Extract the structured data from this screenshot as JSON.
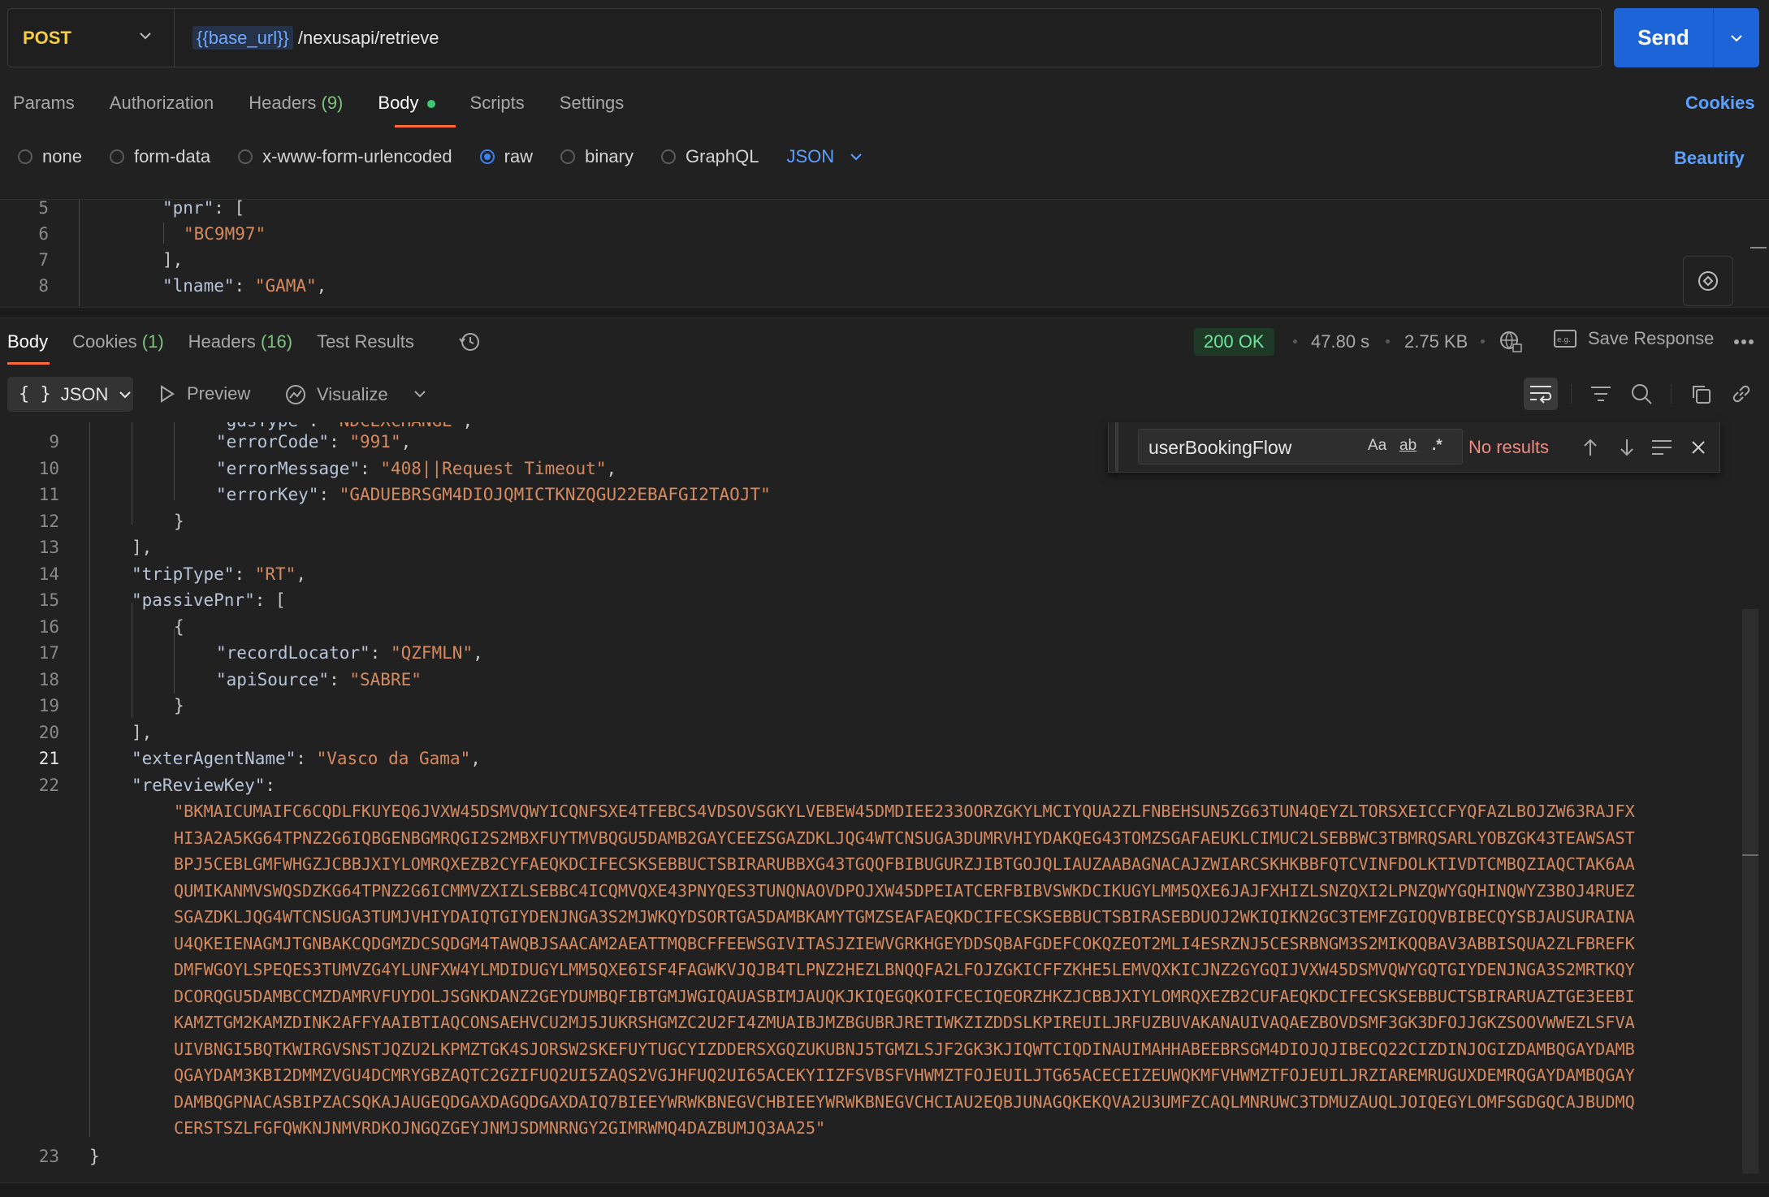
{
  "request": {
    "method": "POST",
    "url_variable": "{{base_url}}",
    "url_path": " /nexusapi/retrieve",
    "send_label": "Send"
  },
  "request_tabs": {
    "params": "Params",
    "authorization": "Authorization",
    "headers": "Headers",
    "headers_count": "(9)",
    "body": "Body",
    "scripts": "Scripts",
    "settings": "Settings",
    "cookies": "Cookies"
  },
  "body_types": {
    "none": "none",
    "form_data": "form-data",
    "urlencoded": "x-www-form-urlencoded",
    "raw": "raw",
    "binary": "binary",
    "graphql": "GraphQL",
    "selected_format": "JSON",
    "beautify": "Beautify"
  },
  "request_body_lines": [
    {
      "n": "5",
      "key": "\"pnr\"",
      "rest": ": ["
    },
    {
      "n": "6",
      "str": "\"BC9M97\""
    },
    {
      "n": "7",
      "punct": "],"
    },
    {
      "n": "8",
      "key": "\"lname\"",
      "rest": ": ",
      "str": "\"GAMA\"",
      "tail": ","
    }
  ],
  "response_tabs": {
    "body": "Body",
    "cookies": "Cookies",
    "cookies_count": "(1)",
    "headers": "Headers",
    "headers_count": "(16)",
    "test_results": "Test Results"
  },
  "response_meta": {
    "status": "200 OK",
    "time": "47.80 s",
    "size": "2.75 KB",
    "save_response": "Save Response"
  },
  "response_toolbar": {
    "format": "JSON",
    "preview": "Preview",
    "visualize": "Visualize"
  },
  "find": {
    "query": "userBookingFlow",
    "match_case": "Aa",
    "whole_word": "ab",
    "regex": ".*",
    "result": "No results"
  },
  "response_lines": [
    {
      "n": "9",
      "indent": 2,
      "key": "\"errorCode\"",
      "str": "\"991\"",
      "tail": ","
    },
    {
      "n": "10",
      "indent": 2,
      "key": "\"errorMessage\"",
      "str": "\"408||Request Timeout\"",
      "tail": ","
    },
    {
      "n": "11",
      "indent": 2,
      "key": "\"errorKey\"",
      "str": "\"GADUEBRSGM4DIOJQMICTKNZQGU22EBAFGI2TAOJT\""
    },
    {
      "n": "12",
      "indent": 1,
      "punct": "}"
    },
    {
      "n": "13",
      "indent": 0,
      "punct": "],"
    },
    {
      "n": "14",
      "indent": 0,
      "key": "\"tripType\"",
      "str": "\"RT\"",
      "tail": ","
    },
    {
      "n": "15",
      "indent": 0,
      "key": "\"passivePnr\"",
      "punct": ": ["
    },
    {
      "n": "16",
      "indent": 1,
      "punct": "{"
    },
    {
      "n": "17",
      "indent": 2,
      "key": "\"recordLocator\"",
      "str": "\"QZFMLN\"",
      "tail": ","
    },
    {
      "n": "18",
      "indent": 2,
      "key": "\"apiSource\"",
      "str": "\"SABRE\""
    },
    {
      "n": "19",
      "indent": 1,
      "punct": "}"
    },
    {
      "n": "20",
      "indent": 0,
      "punct": "],"
    },
    {
      "n": "21",
      "indent": 0,
      "key": "\"exterAgentName\"",
      "str": "\"Vasco da Gama\"",
      "tail": ","
    },
    {
      "n": "22",
      "indent": 0,
      "key": "\"reReviewKey\"",
      "punct": ":"
    }
  ],
  "rereview_value_lines": [
    "\"BKMAICUMAIFC6CQDLFKUYEQ6JVXW45DSMVQWYICQNFSXE4TFEBCS4VDSOVSGKYLVEBEW45DMDIEE233OORZGKYLMCIYQUA2ZLFNBEHSUN5ZG63TUN4QEYZLTORSXEICCFYQFAZLBOJZW63RAJFX",
    "HI3A2A5KG64TPNZ2G6IQBGENBGMRQGI2S2MBXFUYTMVBQGU5DAMB2GAYCEEZSGAZDKLJQG4WTCNSUGA3DUMRVHIYDAKQEG43TOMZSGAFAEUKLCIMUC2LSEBBWC3TBMRQSARLYOBZGK43TEAWSAST",
    "BPJ5CEBLGMFWHGZJCBBJXIYLOMRQXEZB2CYFAEQKDCIFECSKSEBBUCTSBIRARUBBXG43TGQQFBIBUGURZJIBTGOJQLIAUZAABAGNACAJZWIARCSKHKBBFQTCVINFDOLKTIVDTCMBQZIAQCTAK6AA",
    "QUMIKANMVSWQSDZKG64TPNZ2G6ICMMVZXIZLSEBBC4ICQMVQXE43PNYQES3TUNQNAOVDPOJXW45DPEIATCERFBIBVSWKDCIKUGYLMM5QXE6JAJFXHIZLSNZQXI2LPNZQWYGQHINQWYZ3BOJ4RUEZ",
    "SGAZDKLJQG4WTCNSUGA3TUMJVHIYDAIQTGIYDENJNGA3S2MJWKQYDSORTGA5DAMBKAMYTGMZSEAFAEQKDCIFECSKSEBBUCTSBIRASEBDUOJ2WKIQIKN2GC3TEMFZGIOQVBIBECQYSBJAUSURAINA",
    "U4QKEIENAGMJTGNBAKCQDGMZDCSQDGM4TAWQBJSAACAM2AEATTMQBCFFEEWSGIVITASJZIEWVGRKHGEYDDSQBAFGDEFCOKQZEOT2MLI4ESRZNJ5CESRBNGM3S2MIKQQBAV3ABBISQUA2ZLFBREFK",
    "DMFWGOYLSPEQES3TUMVZG4YLUNFXW4YLMDIDUGYLMM5QXE6ISF4FAGWKVJQJB4TLPNZ2HEZLBNQQFA2LFOJZGKICFFZKHE5LEMVQXKICJNZ2GYGQIJVXW45DSMVQWYGQTGIYDENJNGA3S2MRTKQY",
    "DCORQGU5DAMBCCMZDAMRVFUYDOLJSGNKDANZ2GEYDUMBQFIBTGMJWGIQAUASBIMJAUQKJKIQEGQKOIFCECIQEORZHKZJCBBJXIYLOMRQXEZB2CUFAEQKDCIFECSKSEBBUCTSBIRARUAZTGE3EEBI",
    "KAMZTGM2KAMZDINK2AFFYAAIBTIAQCONSAEHVCU2MJ5JUKRSHGMZC2U2FI4ZMUAIBJMZBGUBRJRETIWKZIZDDSLKPIREUILJRFUZBUVAKANAUIVAQAEZBOVDSMF3GK3DFOJJGKZSOOVWWEZLSFVA",
    "UIVBNGI5BQTKWIRGVSNSTJQZU2LKPMZTGK4SJORSW2SKEFUYTUGCYIZDDERSXGQZUKUBNJ5TGMZLSJF2GK3KJIQWTCIQDINAUIMAHHABEEBRSGM4DIOJQJIBECQ22CIZDINJOGIZDAMBQGAYDAMB",
    "QGAYDAM3KBI2DMMZVGU4DCMRYGBZAQTC2GZIFUQ2UI5ZAQS2VGJHFUQ2UI65ACEKYIIZFSVBSFVHWMZTFOJEUILJTG65ACECEIZEUWQKMFVHWMZTFOJEUILJRZIAREMRUGUXDEMRQGAYDAMBQGAY",
    "DAMBQGPNACASBIPZACSQKAJAUGEQDGAXDAGQDGAXDAIQ7BIEEYWRWKBNEGVCHBIEEYWRWKBNEGVCHCIAU2EQBJUNAGQKEKQVA2U3UMFZCAQLMNRUWC3TDMUZAUQLJOIQEGYLOMFSGDGQCAJBUDMQ",
    "CERSTSZLFGFQWKNJNMVRDKOJNGQZGEYJNMJSDMNRNGY2GIMRWMQ4DAZBUMJQ3AA25\""
  ],
  "closing_line": {
    "n": "23",
    "punct": "}"
  }
}
